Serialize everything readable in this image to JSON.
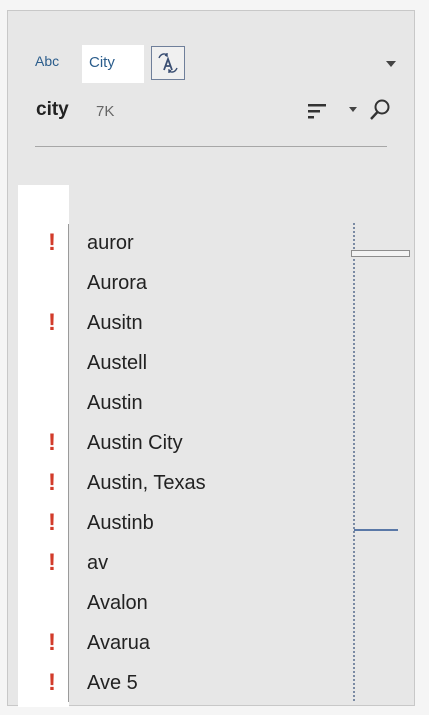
{
  "profile_card": {
    "data_type_label": "Abc",
    "data_role": "City",
    "field_name": "city",
    "distinct_count": "7K"
  },
  "values": [
    {
      "label": "auror",
      "flagged": true
    },
    {
      "label": "Aurora",
      "flagged": false
    },
    {
      "label": "Ausitn",
      "flagged": true
    },
    {
      "label": "Austell",
      "flagged": false
    },
    {
      "label": "Austin",
      "flagged": false
    },
    {
      "label": "Austin City",
      "flagged": true
    },
    {
      "label": "Austin, Texas",
      "flagged": true
    },
    {
      "label": "Austinb",
      "flagged": true
    },
    {
      "label": "av",
      "flagged": true
    },
    {
      "label": "Avalon",
      "flagged": false
    },
    {
      "label": "Avarua",
      "flagged": true
    },
    {
      "label": "Ave 5",
      "flagged": true
    }
  ],
  "flag_glyph": "!",
  "colors": {
    "flag": "#d23b2a",
    "role_text": "#2b5d8c",
    "scroll_marker": "#5a78a7",
    "panel_bg": "#e7e7e7"
  },
  "icons": {
    "clean": "clean-icon",
    "menu": "chevron-down-icon",
    "sort": "sort-icon",
    "search": "search-icon"
  }
}
